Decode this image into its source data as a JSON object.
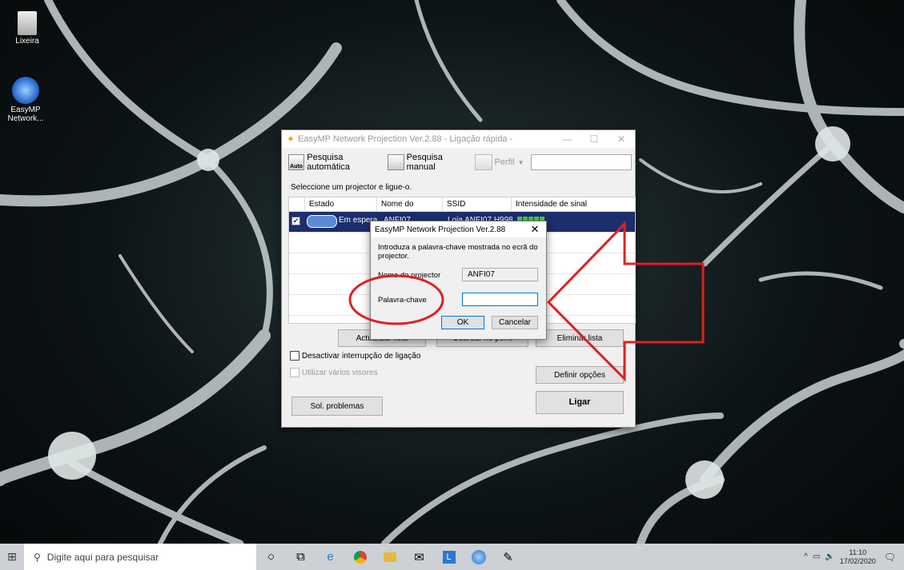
{
  "desktop": {
    "icons": [
      {
        "label": "Lixeira"
      },
      {
        "label": "EasyMP Network..."
      }
    ]
  },
  "main_window": {
    "title": "EasyMP Network Projection Ver.2.88 - Ligação rápida -",
    "toolbar": {
      "auto_icon_text": "Auto",
      "auto_search": "Pesquisa automática",
      "manual_search": "Pesquisa manual",
      "profile": "Perfil"
    },
    "instruction": "Seleccione um projector e ligue-o.",
    "columns": [
      "Estado",
      "Nome do projector",
      "SSID",
      "Intensidade de sinal"
    ],
    "row": {
      "status": "Em espera",
      "name": "ANFI07",
      "ssid": "Loja ANFI07 H998"
    },
    "buttons": {
      "update_list": "Actualizar lista",
      "save_profile": "Guardar no perfil",
      "delete_list": "Eliminar lista",
      "set_options": "Definir opções",
      "troubleshoot": "Sol. problemas",
      "connect": "Ligar"
    },
    "checkboxes": {
      "disable_interrupt": "Desactivar interrupção de ligação",
      "multiple_displays": "Utilizar vários visores"
    }
  },
  "dialog": {
    "title": "EasyMP Network Projection Ver.2.88",
    "message": "Introduza a palavra-chave mostrada no ecrã do projector.",
    "projector_label": "Nome do projector",
    "projector_value": "ANFI07",
    "keyword_label": "Palavra-chave",
    "keyword_value": "",
    "ok": "OK",
    "cancel": "Cancelar"
  },
  "taskbar": {
    "search_placeholder": "Digite aqui para pesquisar",
    "time": "11:10",
    "date": "17/02/2020"
  },
  "colors": {
    "annotation": "#e02020",
    "selection": "#1c2e6e",
    "signal": "#4aca4a"
  }
}
